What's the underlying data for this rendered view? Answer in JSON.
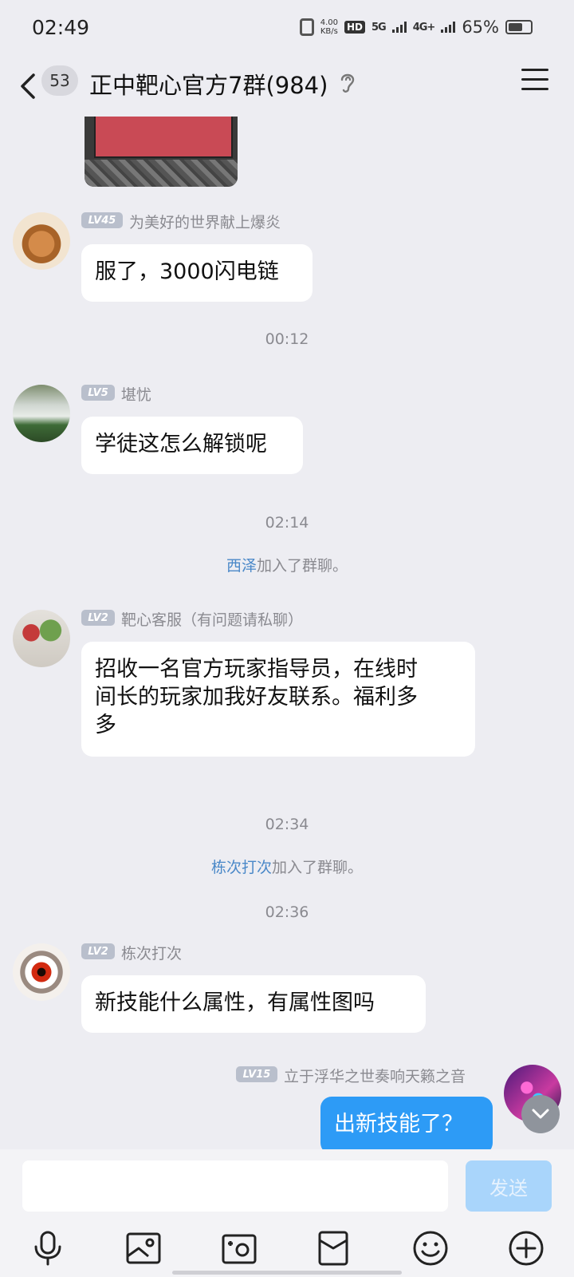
{
  "status_bar": {
    "time": "02:49",
    "net_speed_value": "4.00",
    "net_speed_unit": "KB/s",
    "hd": "HD",
    "net_5g": "5G",
    "net_4g": "4G+",
    "battery_percent": "65%",
    "battery_level": 0.65
  },
  "header": {
    "unread_count": "53",
    "title": "正中靶心官方7群(984)",
    "back_icon": "chevron-left-icon",
    "ear_icon": "ear-icon",
    "menu_icon": "menu-icon"
  },
  "messages": [
    {
      "level": "LV45",
      "nickname": "为美好的世界献上爆炎",
      "text": "服了，3000闪电链"
    },
    {
      "level": "LV5",
      "nickname": "堪忧",
      "text": "学徒这怎么解锁呢"
    },
    {
      "level": "LV2",
      "nickname": "靶心客服（有问题请私聊）",
      "lines": [
        "招收一名官方玩家指导员，在线时",
        "间长的玩家加我好友联系。福利多",
        "多"
      ]
    },
    {
      "level": "LV2",
      "nickname": "栋次打次",
      "text": "新技能什么属性，有属性图吗"
    },
    {
      "level": "LV15",
      "nickname": "立于浮华之世奏响天籁之音",
      "text": "出新技能了？"
    }
  ],
  "timestamps": [
    "00:12",
    "02:14",
    "02:34",
    "02:36"
  ],
  "system_messages": [
    {
      "who": "西泽",
      "text": "加入了群聊。"
    },
    {
      "who": "栋次打次",
      "text": "加入了群聊。"
    }
  ],
  "input": {
    "placeholder": "",
    "send_label": "发送"
  },
  "toolbar_icons": [
    "microphone-icon",
    "image-icon",
    "camera-icon",
    "red-packet-icon",
    "emoji-icon",
    "plus-icon"
  ],
  "colors": {
    "background": "#ededf2",
    "bubble_mine": "#2d9bf6",
    "send_disabled": "#a9d5fb",
    "link": "#4a88c8"
  }
}
